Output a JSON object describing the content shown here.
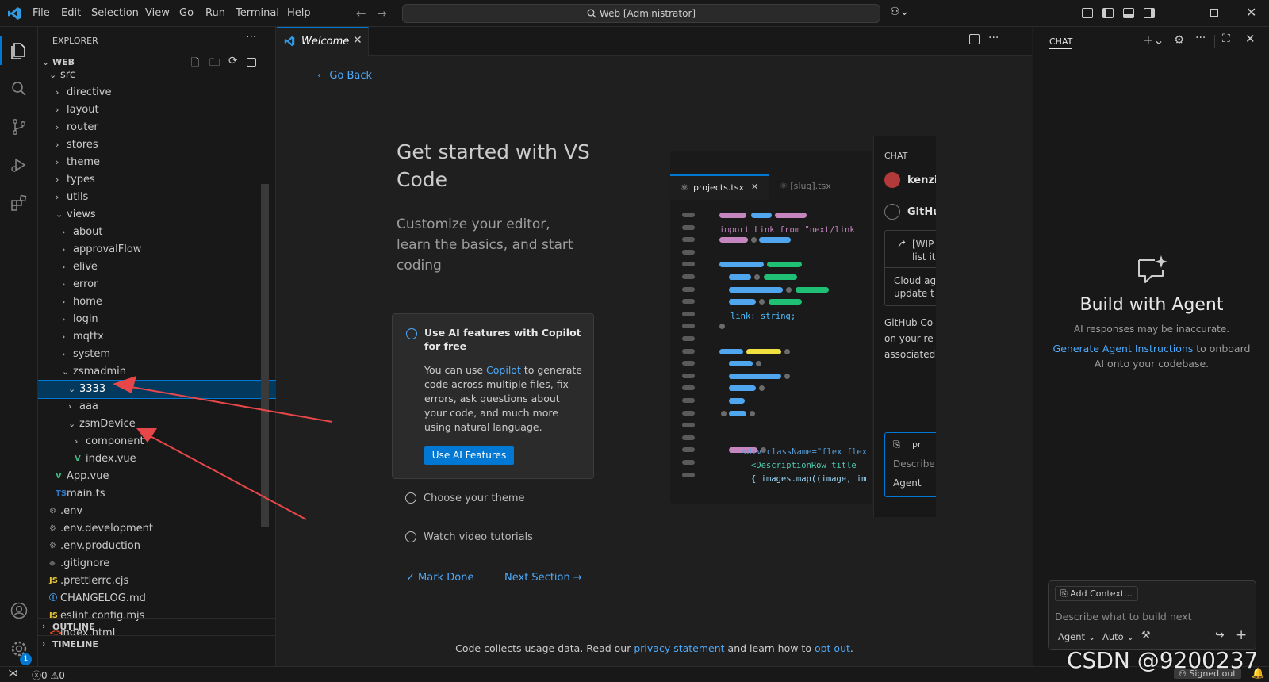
{
  "menubar": {
    "items": [
      "File",
      "Edit",
      "Selection",
      "View",
      "Go",
      "Run",
      "Terminal",
      "Help"
    ],
    "command_center": "Web [Administrator]"
  },
  "explorer": {
    "title": "EXPLORER",
    "root": "WEB",
    "tree": [
      {
        "label": "src",
        "open": true,
        "level": 0
      },
      {
        "label": "directive",
        "open": false,
        "level": 1
      },
      {
        "label": "layout",
        "open": false,
        "level": 1
      },
      {
        "label": "router",
        "open": false,
        "level": 1
      },
      {
        "label": "stores",
        "open": false,
        "level": 1
      },
      {
        "label": "theme",
        "open": false,
        "level": 1
      },
      {
        "label": "types",
        "open": false,
        "level": 1
      },
      {
        "label": "utils",
        "open": false,
        "level": 1
      },
      {
        "label": "views",
        "open": true,
        "level": 1
      },
      {
        "label": "about",
        "open": false,
        "level": 2
      },
      {
        "label": "approvalFlow",
        "open": false,
        "level": 2
      },
      {
        "label": "elive",
        "open": false,
        "level": 2
      },
      {
        "label": "error",
        "open": false,
        "level": 2
      },
      {
        "label": "home",
        "open": false,
        "level": 2
      },
      {
        "label": "login",
        "open": false,
        "level": 2
      },
      {
        "label": "mqttx",
        "open": false,
        "level": 2
      },
      {
        "label": "system",
        "open": false,
        "level": 2
      },
      {
        "label": "zsmadmin",
        "open": true,
        "level": 2
      },
      {
        "label": "3333",
        "open": true,
        "level": 3,
        "selected": true
      },
      {
        "label": "aaa",
        "open": false,
        "level": 3
      },
      {
        "label": "zsmDevice",
        "open": true,
        "level": 3
      },
      {
        "label": "component",
        "open": false,
        "level": 4
      },
      {
        "label": "index.vue",
        "file": "vue",
        "level": 4
      },
      {
        "label": "App.vue",
        "file": "vue",
        "level": 1
      },
      {
        "label": "main.ts",
        "file": "ts",
        "level": 1
      },
      {
        "label": ".env",
        "file": "gear",
        "level": 0
      },
      {
        "label": ".env.development",
        "file": "gear",
        "level": 0
      },
      {
        "label": ".env.production",
        "file": "gear",
        "level": 0
      },
      {
        "label": ".gitignore",
        "file": "git",
        "level": 0
      },
      {
        "label": ".prettierrc.cjs",
        "file": "js",
        "level": 0
      },
      {
        "label": "CHANGELOG.md",
        "file": "info",
        "level": 0
      },
      {
        "label": "eslint.config.mjs",
        "file": "js",
        "level": 0
      },
      {
        "label": "index.html",
        "file": "html",
        "level": 0
      }
    ],
    "outline": "OUTLINE",
    "timeline": "TIMELINE"
  },
  "editor": {
    "tab_label": "Welcome",
    "go_back": "Go Back",
    "heading": "Get started with VS Code",
    "subheading": "Customize your editor, learn the basics, and start coding",
    "card": {
      "title": "Use AI features with Copilot for free",
      "desc_pre": "You can use ",
      "desc_link": "Copilot",
      "desc_post": " to generate code across multiple files, fix errors, ask questions about your code, and much more using natural language.",
      "button": "Use AI Features"
    },
    "steps": [
      "Choose your theme",
      "Watch video tutorials"
    ],
    "mark_done": "Mark Done",
    "next_section": "Next Section",
    "footer_pre": "Code collects usage data. Read our ",
    "footer_link1": "privacy statement",
    "footer_mid": " and learn how to ",
    "footer_link2": "opt out",
    "footer_post": "."
  },
  "preview": {
    "tab1": "projects.tsx",
    "tab2": "[slug].tsx",
    "code_import": "import Link from \"next/link",
    "code_link": "link: string;",
    "code_div": "<div className=\"flex flex",
    "code_desc": "<DescriptionRow title",
    "code_map": "{ images.map((image, im",
    "chat_title": "CHAT",
    "chat_user": "kenzi",
    "chat_github": "GitHu",
    "chat_wip": "[WIP",
    "chat_list": "list it",
    "chat_cloud": "Cloud ag",
    "chat_update": "update t",
    "chat_p1": "GitHub Co",
    "chat_p2": "on your re",
    "chat_p3": "associated",
    "chat_pr": "pr",
    "chat_describe": "Describe",
    "chat_agent": "Agent"
  },
  "chat": {
    "tab": "CHAT",
    "heading": "Build with Agent",
    "disclaimer": "AI responses may be inaccurate.",
    "link": "Generate Agent Instructions",
    "link_post": " to onboard AI onto your codebase.",
    "add_context": "Add Context...",
    "placeholder": "Describe what to build next",
    "mode": "Agent",
    "model": "Auto"
  },
  "statusbar": {
    "errors": "0",
    "warnings": "0",
    "signed_out": "Signed out"
  },
  "watermark": "CSDN @9200237",
  "colors": {
    "accent": "#0078d4",
    "link": "#4daafc",
    "selection": "#04395e",
    "annotation_arrow": "#e8474a"
  }
}
